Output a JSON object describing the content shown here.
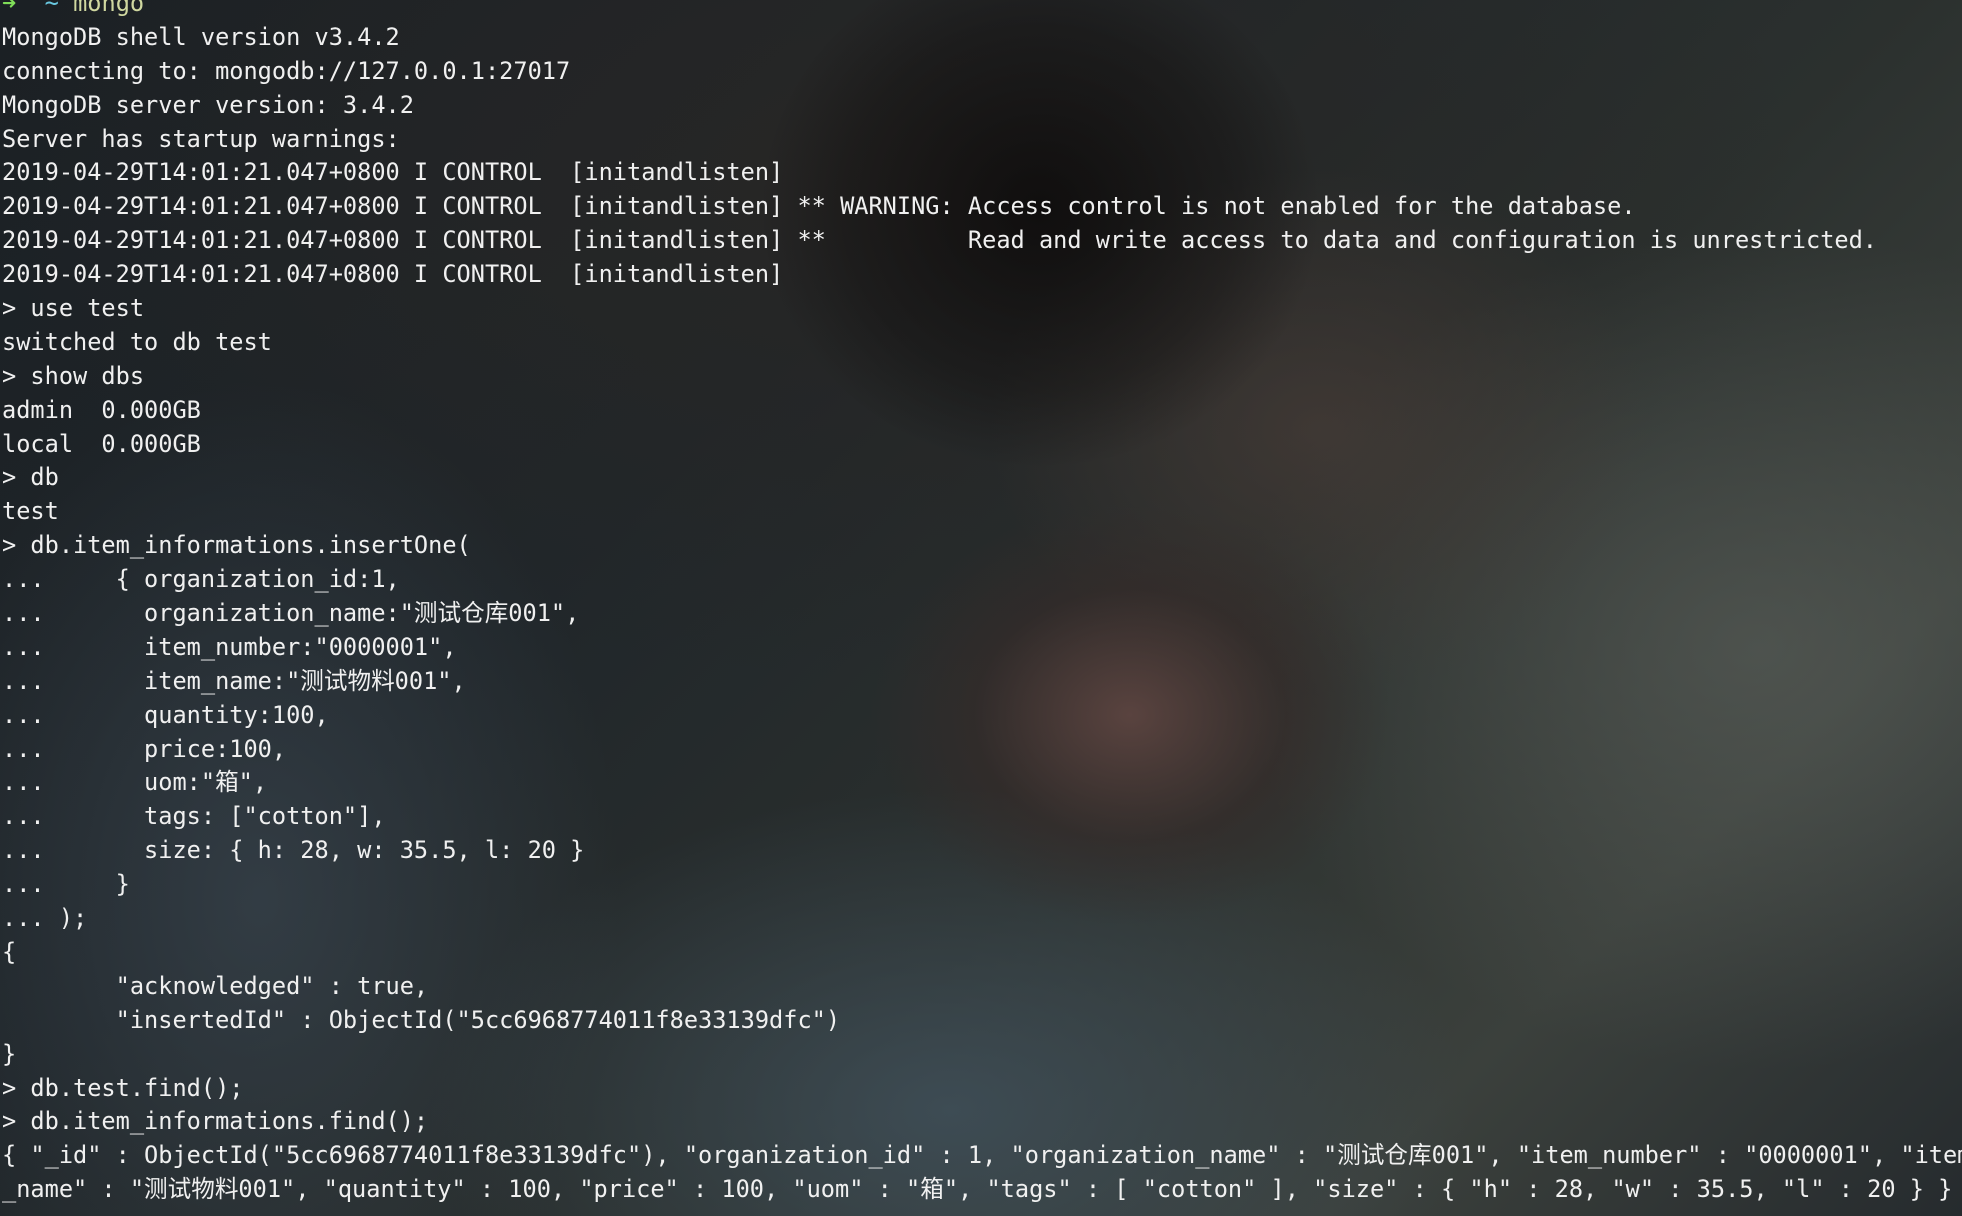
{
  "prompt": {
    "arrow": "➜",
    "dir": "~",
    "command": "mongo"
  },
  "lines": [
    "MongoDB shell version v3.4.2",
    "connecting to: mongodb://127.0.0.1:27017",
    "MongoDB server version: 3.4.2",
    "Server has startup warnings:",
    "2019-04-29T14:01:21.047+0800 I CONTROL  [initandlisten]",
    "2019-04-29T14:01:21.047+0800 I CONTROL  [initandlisten] ** WARNING: Access control is not enabled for the database.",
    "2019-04-29T14:01:21.047+0800 I CONTROL  [initandlisten] **          Read and write access to data and configuration is unrestricted.",
    "2019-04-29T14:01:21.047+0800 I CONTROL  [initandlisten]",
    "> use test",
    "switched to db test",
    "> show dbs",
    "admin  0.000GB",
    "local  0.000GB",
    "> db",
    "test",
    "> db.item_informations.insertOne(",
    "...     { organization_id:1,",
    "...       organization_name:\"测试仓库001\",",
    "...       item_number:\"0000001\",",
    "...       item_name:\"测试物料001\",",
    "...       quantity:100,",
    "...       price:100,",
    "...       uom:\"箱\",",
    "...       tags: [\"cotton\"],",
    "...       size: { h: 28, w: 35.5, l: 20 }",
    "...     }",
    "... );",
    "{",
    "        \"acknowledged\" : true,",
    "        \"insertedId\" : ObjectId(\"5cc6968774011f8e33139dfc\")",
    "}",
    "> db.test.find();",
    "> db.item_informations.find();",
    "{ \"_id\" : ObjectId(\"5cc6968774011f8e33139dfc\"), \"organization_id\" : 1, \"organization_name\" : \"测试仓库001\", \"item_number\" : \"0000001\", \"item",
    "_name\" : \"测试物料001\", \"quantity\" : 100, \"price\" : 100, \"uom\" : \"箱\", \"tags\" : [ \"cotton\" ], \"size\" : { \"h\" : 28, \"w\" : 35.5, \"l\" : 20 } }"
  ]
}
